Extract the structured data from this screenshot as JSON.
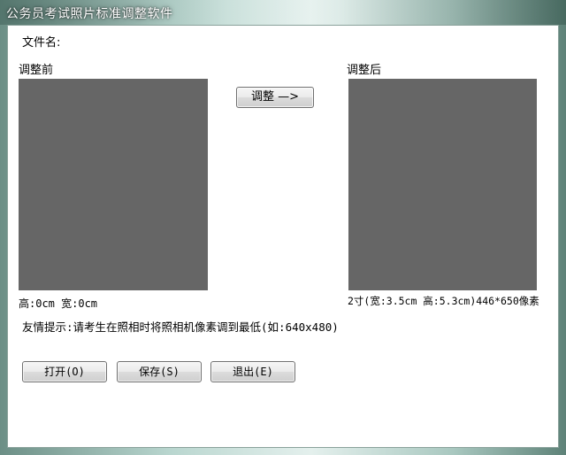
{
  "window": {
    "title": "公务员考试照片标准调整软件"
  },
  "file": {
    "label": "文件名:"
  },
  "before": {
    "label": "调整前",
    "info": "高:0cm  宽:0cm"
  },
  "after": {
    "label": "调整后",
    "info": "2寸(宽:3.5cm 高:5.3cm)446*650像素"
  },
  "adjust_button": {
    "label": "调整 —>"
  },
  "tip": "友情提示:请考生在照相时将照相机像素调到最低(如:640x480)",
  "buttons": {
    "open": "打开(O)",
    "save": "保存(S)",
    "exit": "退出(E)"
  },
  "colors": {
    "photo_placeholder": "#666666"
  }
}
